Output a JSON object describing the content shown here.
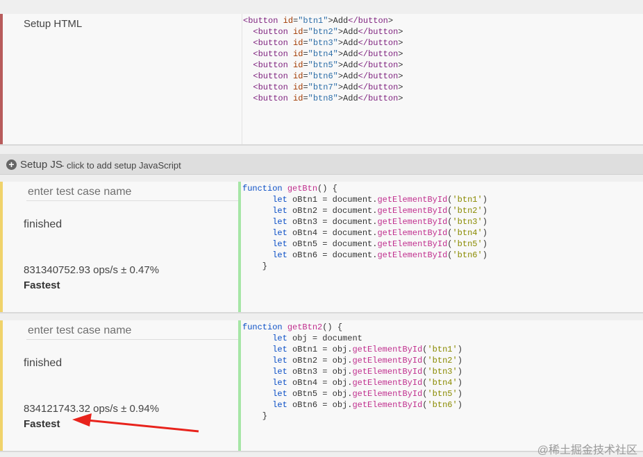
{
  "setup_html": {
    "label": "Setup HTML",
    "lines": [
      "<button id=\"btn1\">Add</button>",
      "  <button id=\"btn2\">Add</button>",
      "  <button id=\"btn3\">Add</button>",
      "  <button id=\"btn4\">Add</button>",
      "  <button id=\"btn5\">Add</button>",
      "  <button id=\"btn6\">Add</button>",
      "  <button id=\"btn7\">Add</button>",
      "  <button id=\"btn8\">Add</button>"
    ]
  },
  "setup_js": {
    "title": "Setup JS",
    "hint": " - click to add setup JavaScript"
  },
  "tests": [
    {
      "name_placeholder": "enter test case name",
      "status": "finished",
      "result": "831340752.93 ops/s ± 0.47%",
      "badge": "Fastest",
      "code": [
        "function getBtn() {",
        "      let oBtn1 = document.getElementById('btn1')",
        "      let oBtn2 = document.getElementById('btn2')",
        "      let oBtn3 = document.getElementById('btn3')",
        "      let oBtn4 = document.getElementById('btn4')",
        "      let oBtn5 = document.getElementById('btn5')",
        "      let oBtn6 = document.getElementById('btn6')",
        "    }"
      ]
    },
    {
      "name_placeholder": "enter test case name",
      "status": "finished",
      "result": "834121743.32 ops/s ± 0.94%",
      "badge": "Fastest",
      "code": [
        "function getBtn2() {",
        "      let obj = document",
        "      let oBtn1 = obj.getElementById('btn1')",
        "      let oBtn2 = obj.getElementById('btn2')",
        "      let oBtn3 = obj.getElementById('btn3')",
        "      let oBtn4 = obj.getElementById('btn4')",
        "      let oBtn5 = obj.getElementById('btn5')",
        "      let oBtn6 = obj.getElementById('btn6')",
        "    }"
      ]
    }
  ],
  "watermark": "@稀土掘金技术社区",
  "colors": {
    "setup_bar": "#b85c5c",
    "test_bar": "#f0d36b",
    "code_divider": "#a6e6a6",
    "arrow": "#e8231c"
  }
}
